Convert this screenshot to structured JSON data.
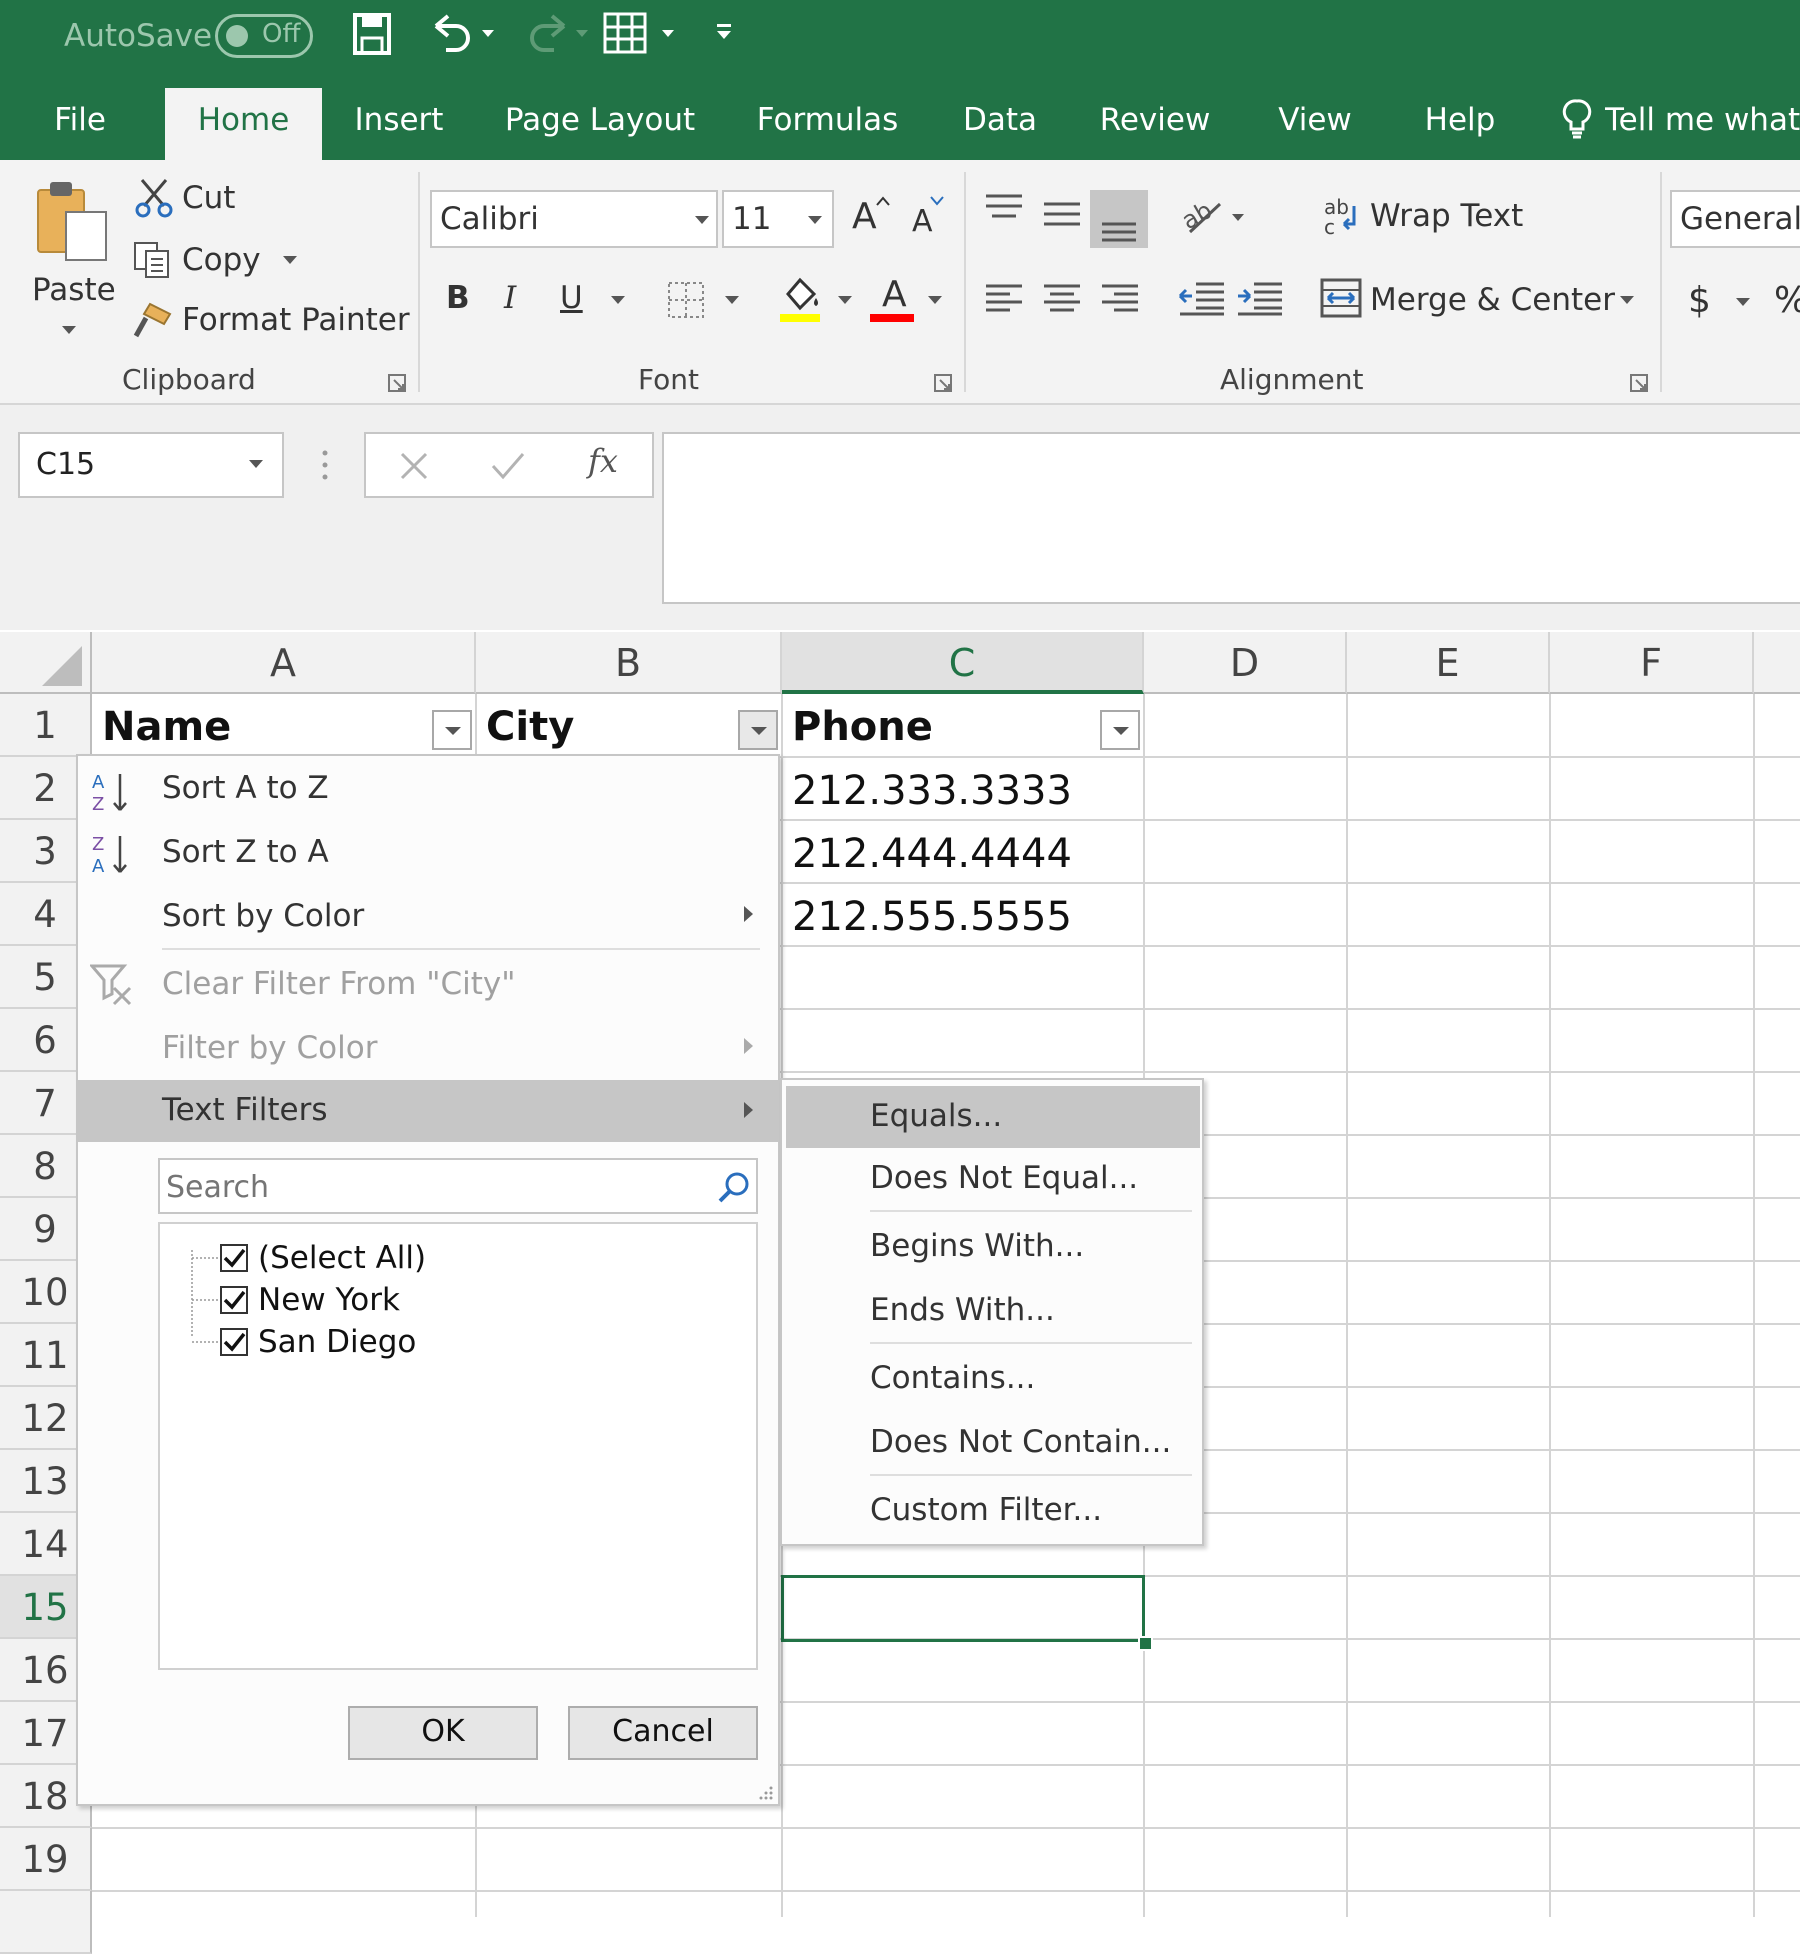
{
  "qat": {
    "autosave_label": "AutoSave",
    "autosave_state": "Off"
  },
  "tabs": [
    "File",
    "Home",
    "Insert",
    "Page Layout",
    "Formulas",
    "Data",
    "Review",
    "View",
    "Help"
  ],
  "tell_me": "Tell me what",
  "clipboard": {
    "paste": "Paste",
    "cut": "Cut",
    "copy": "Copy",
    "format_painter": "Format Painter",
    "label": "Clipboard"
  },
  "font": {
    "name": "Calibri",
    "size": "11",
    "bold": "B",
    "italic": "I",
    "underline": "U",
    "color_letter": "A",
    "label": "Font",
    "grow": "A",
    "shrink": "A"
  },
  "alignment": {
    "wrap_text": "Wrap Text",
    "merge_center": "Merge & Center",
    "label": "Alignment"
  },
  "number": {
    "format": "General",
    "currency": "$",
    "percent": "%"
  },
  "formula_bar": {
    "name_box": "C15",
    "fx": "fx",
    "value": ""
  },
  "columns": [
    "A",
    "B",
    "C",
    "D",
    "E",
    "F"
  ],
  "rows": [
    "1",
    "2",
    "3",
    "4",
    "5",
    "6",
    "7",
    "8",
    "9",
    "10",
    "11",
    "12",
    "13",
    "14",
    "15",
    "16",
    "17",
    "18",
    "19"
  ],
  "cells": {
    "A1": "Name",
    "B1": "City",
    "C1": "Phone",
    "C2": "212.333.3333",
    "C3": "212.444.4444",
    "C4": "212.555.5555"
  },
  "filter_menu": {
    "sort_az": "Sort A to Z",
    "sort_za": "Sort Z to A",
    "sort_color": "Sort by Color",
    "clear_filter": "Clear Filter From \"City\"",
    "filter_color": "Filter by Color",
    "text_filters": "Text Filters",
    "search_placeholder": "Search",
    "items": [
      "(Select All)",
      "New York",
      "San Diego"
    ],
    "ok": "OK",
    "cancel": "Cancel"
  },
  "text_filters_submenu": [
    "Equals...",
    "Does Not Equal...",
    "Begins With...",
    "Ends With...",
    "Contains...",
    "Does Not Contain...",
    "Custom Filter..."
  ],
  "colors": {
    "excel_green": "#217346",
    "highlight_yellow": "#ffff00",
    "font_red": "#ff0000",
    "menu_hover": "#c6c6c6"
  }
}
